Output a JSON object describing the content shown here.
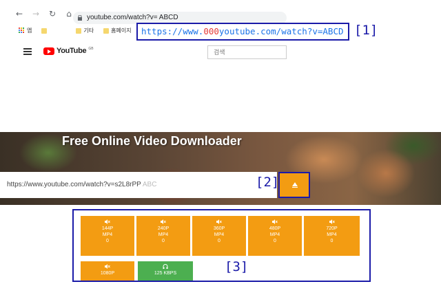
{
  "browser": {
    "url": "youtube.com/watch?v= ABCD",
    "bookmarks": [
      "앱",
      "기타",
      "홈페이지"
    ],
    "nav_icons": [
      "back-icon",
      "forward-icon",
      "reload-icon",
      "home-icon"
    ]
  },
  "annotation1": {
    "url_prefix": "https://www.",
    "url_red": "000",
    "url_suffix": "youtube.com/watch?v=ABCD",
    "label": "[1]"
  },
  "youtube": {
    "logo_text": "YouTube",
    "region": "GB",
    "search_placeholder": "검색"
  },
  "downloader": {
    "title": "Free Online Video Downloader",
    "input_value": "https://www.youtube.com/watch?v=s2L8rPP",
    "input_fade": "ABC",
    "label2": "[2]"
  },
  "formats": [
    {
      "res": "144P",
      "type": "MP4",
      "size": "0"
    },
    {
      "res": "240P",
      "type": "MP4",
      "size": "0"
    },
    {
      "res": "360P",
      "type": "MP4",
      "size": "0"
    },
    {
      "res": "480P",
      "type": "MP4",
      "size": "0"
    },
    {
      "res": "720P",
      "type": "MP4",
      "size": "0"
    },
    {
      "res": "1080P",
      "type": "",
      "size": ""
    },
    {
      "res": "125 KBPS",
      "type": "",
      "size": ""
    }
  ],
  "label3": "[3]",
  "colors": {
    "accent": "#f39c12",
    "green": "#4caf50",
    "annotation": "#1a1aa8",
    "url_blue": "#1a73e8",
    "url_red": "#e53935"
  }
}
